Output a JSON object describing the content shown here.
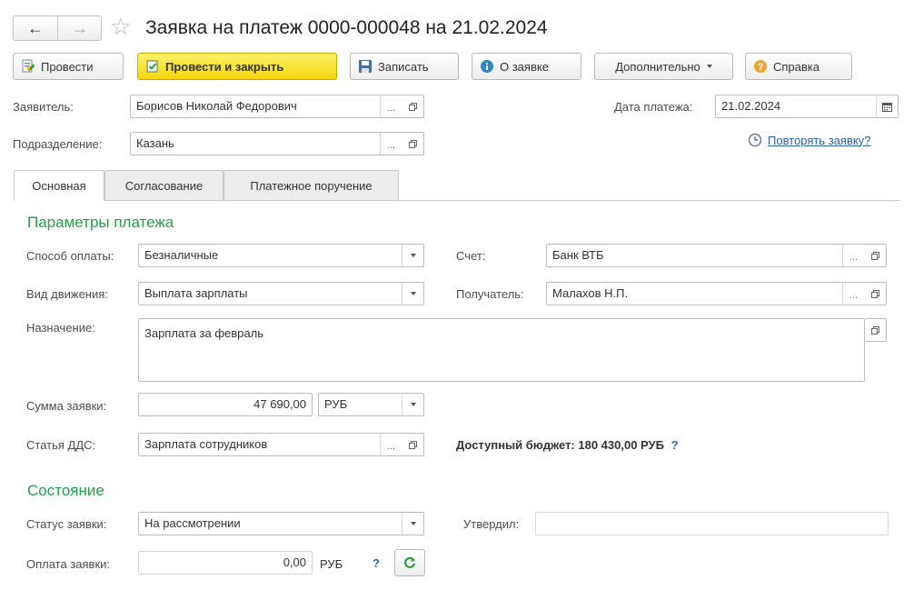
{
  "window": {
    "title": "Заявка на платеж 0000-000048 на 21.02.2024"
  },
  "toolbar": {
    "post_label": "Провести",
    "post_close_label": "Провести и закрыть",
    "save_label": "Записать",
    "about_label": "О заявке",
    "more_label": "Дополнительно",
    "help_label": "Справка"
  },
  "header": {
    "applicant_label": "Заявитель:",
    "applicant_value": "Борисов Николай Федорович",
    "department_label": "Подразделение:",
    "department_value": "Казань",
    "payment_date_label": "Дата платежа:",
    "payment_date_value": "21.02.2024",
    "repeat_link": "Повторять заявку?"
  },
  "tabs": [
    {
      "label": "Основная"
    },
    {
      "label": "Согласование"
    },
    {
      "label": "Платежное поручение"
    }
  ],
  "params": {
    "section_title": "Параметры платежа",
    "pay_method_label": "Способ оплаты:",
    "pay_method_value": "Безналичные",
    "movement_label": "Вид движения:",
    "movement_value": "Выплата зарплаты",
    "account_label": "Счет:",
    "account_value": "Банк ВТБ",
    "recipient_label": "Получатель:",
    "recipient_value": "Малахов Н.П.",
    "purpose_label": "Назначение:",
    "purpose_value": "Зарплата за февраль",
    "amount_label": "Сумма заявки:",
    "amount_value": "47 690,00",
    "currency_value": "РУБ",
    "dds_label": "Статья ДДС:",
    "dds_value": "Зарплата сотрудников",
    "budget_text": "Доступный бюджет: 180 430,00 РУБ",
    "budget_help": "?"
  },
  "state": {
    "section_title": "Состояние",
    "status_label": "Статус заявки:",
    "status_value": "На рассмотрении",
    "approved_label": "Утвердил:",
    "approved_value": "",
    "payment_label": "Оплата заявки:",
    "payment_value": "0,00",
    "payment_currency": "РУБ",
    "payment_help": "?"
  },
  "colors": {
    "accent_green": "#22a14a",
    "primary_yellow": "#f5dc1c",
    "link_blue": "#2b5fa8"
  }
}
